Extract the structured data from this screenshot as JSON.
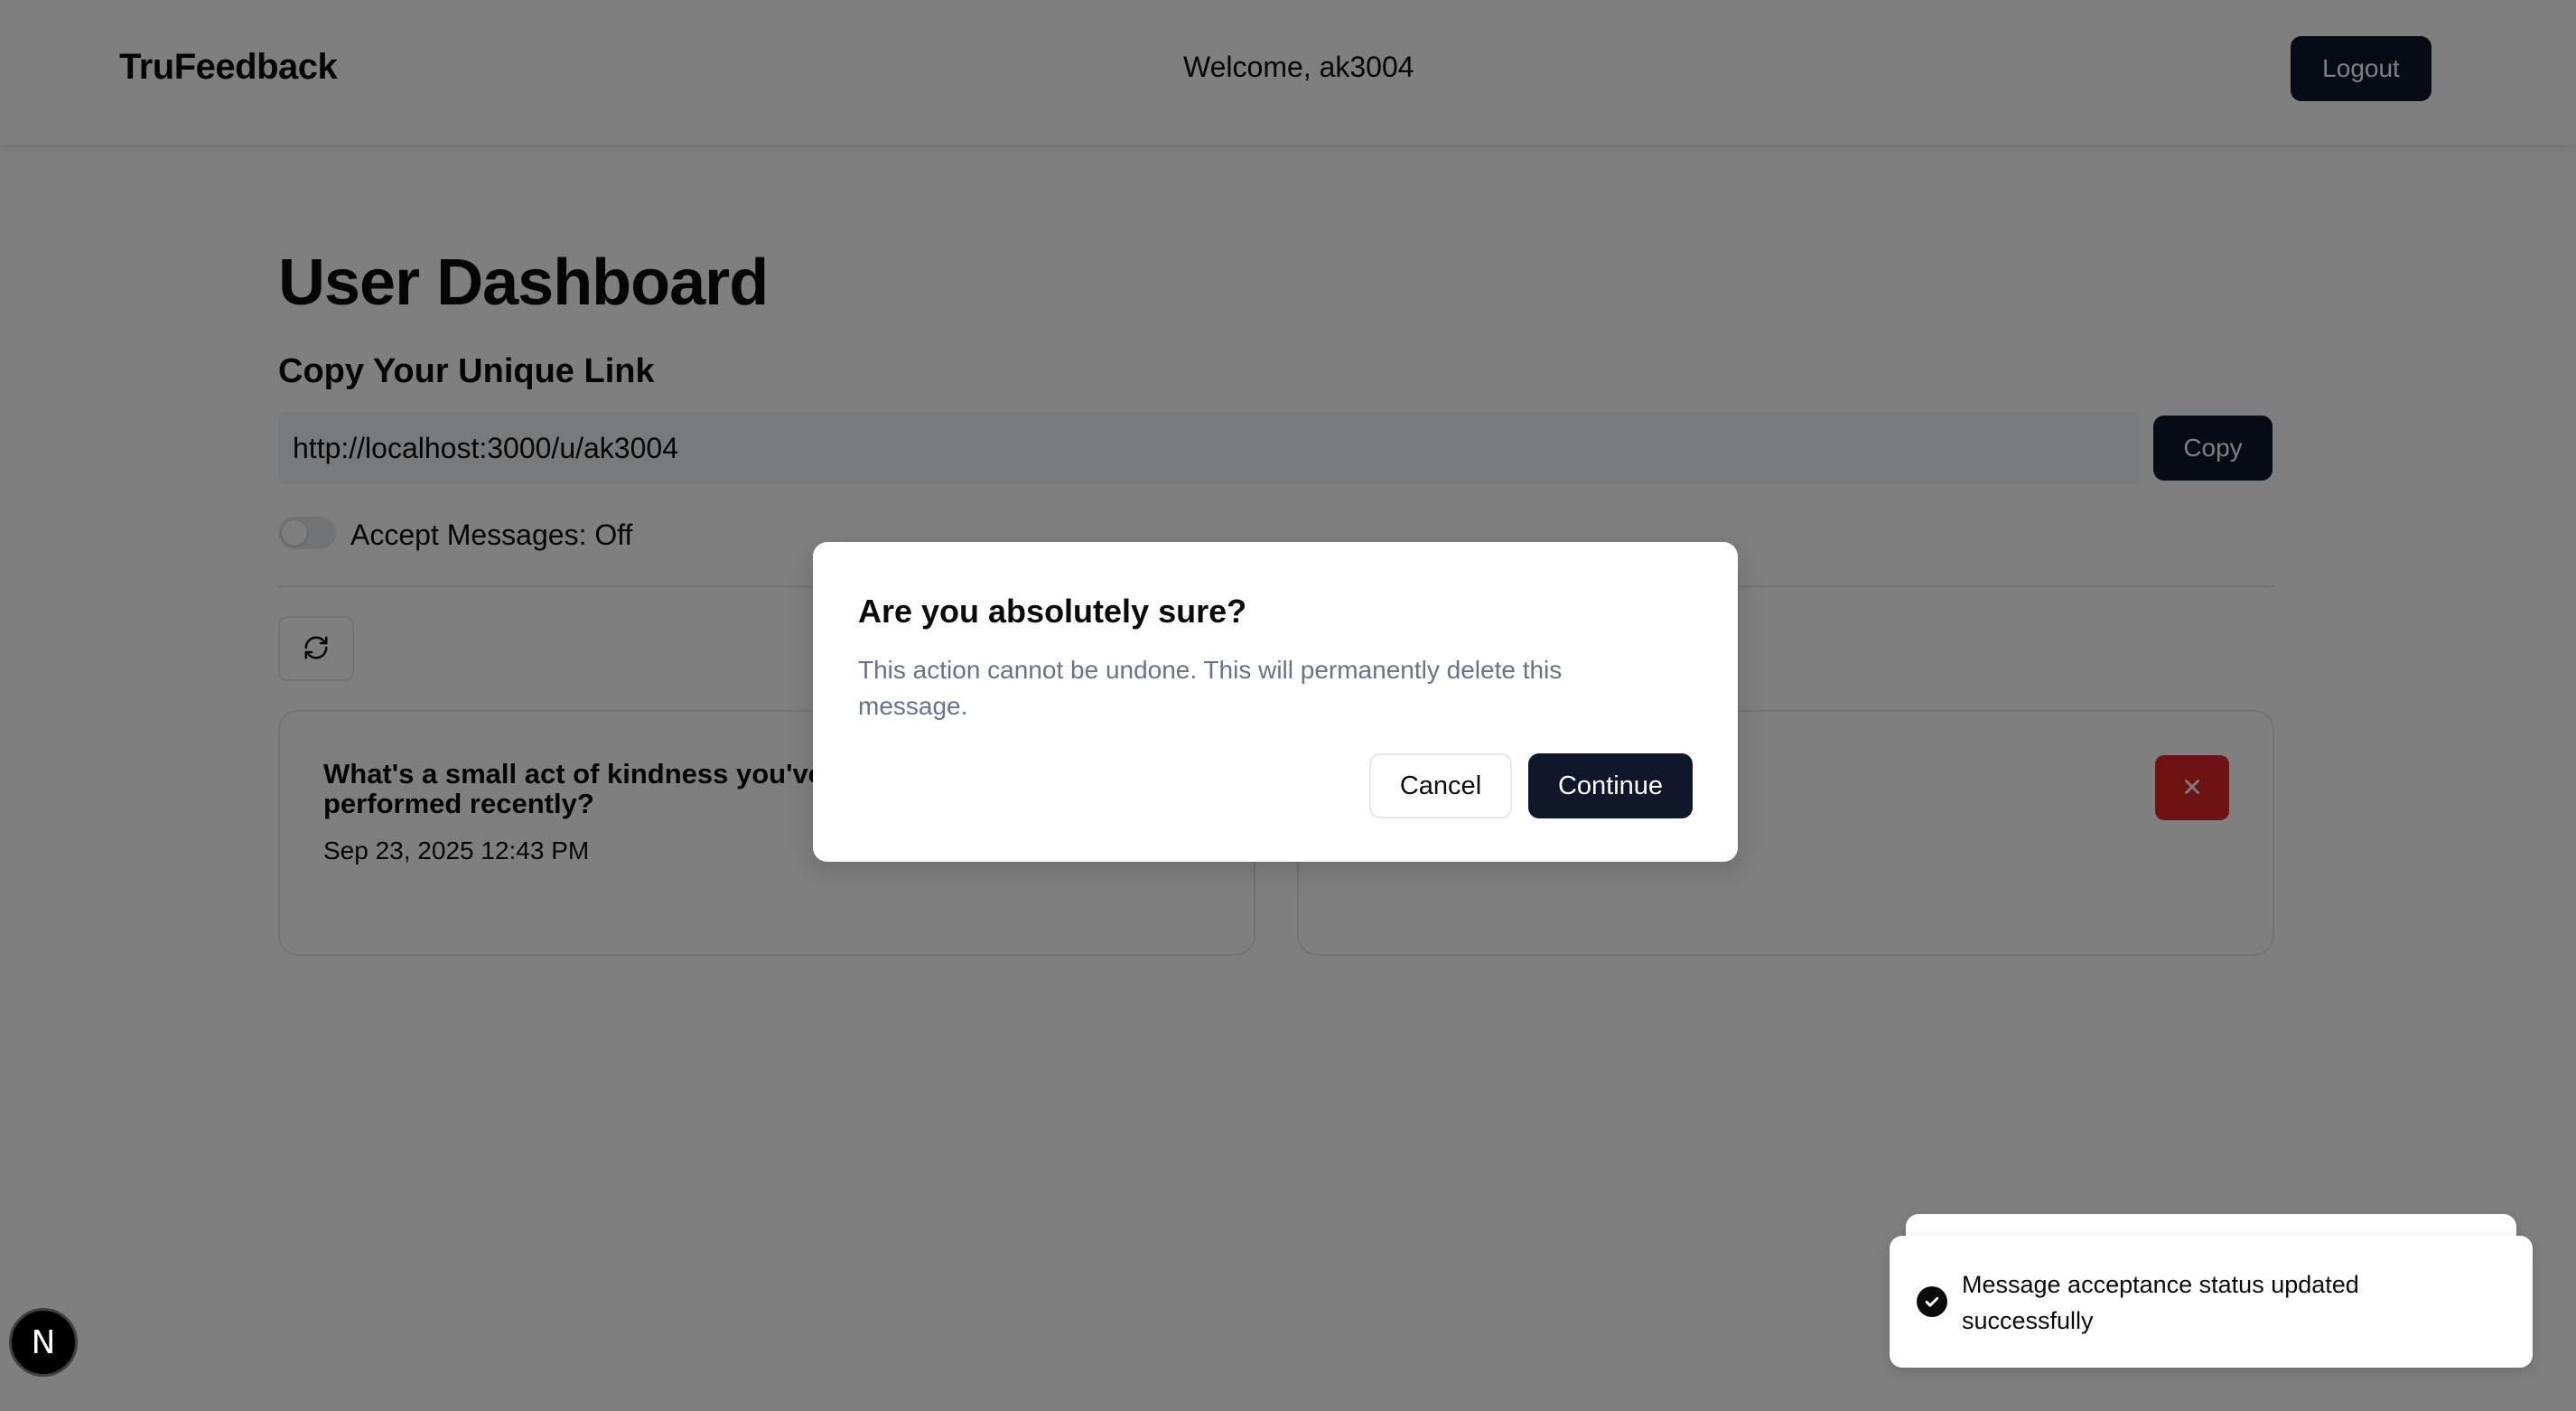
{
  "navbar": {
    "brand": "TruFeedback",
    "welcome": "Welcome, ak3004",
    "logout_label": "Logout"
  },
  "dashboard": {
    "title": "User Dashboard",
    "copy_link_heading": "Copy Your Unique Link",
    "unique_link": "http://localhost:3000/u/ak3004",
    "copy_label": "Copy",
    "accept_messages_label": "Accept Messages: Off",
    "accept_messages_on": false,
    "refresh_icon": "refresh-icon"
  },
  "messages": [
    {
      "content": "What's a small act of kindness you've performed recently?",
      "date": "Sep 23, 2025 12:43 PM",
      "delete_icon": "x-icon"
    },
    {
      "content": "",
      "date": "",
      "delete_icon": "x-icon"
    }
  ],
  "dialog": {
    "title": "Are you absolutely sure?",
    "description": "This action cannot be undone. This will permanently delete this message.",
    "cancel_label": "Cancel",
    "continue_label": "Continue"
  },
  "toast": {
    "message": "Message acceptance status updated successfully",
    "icon": "check-circle-icon"
  },
  "dev_badge": {
    "letter": "N"
  },
  "colors": {
    "primary": "#0f172a",
    "destructive": "#dc2626",
    "muted_text": "#64748b",
    "border": "#e5e7eb"
  }
}
